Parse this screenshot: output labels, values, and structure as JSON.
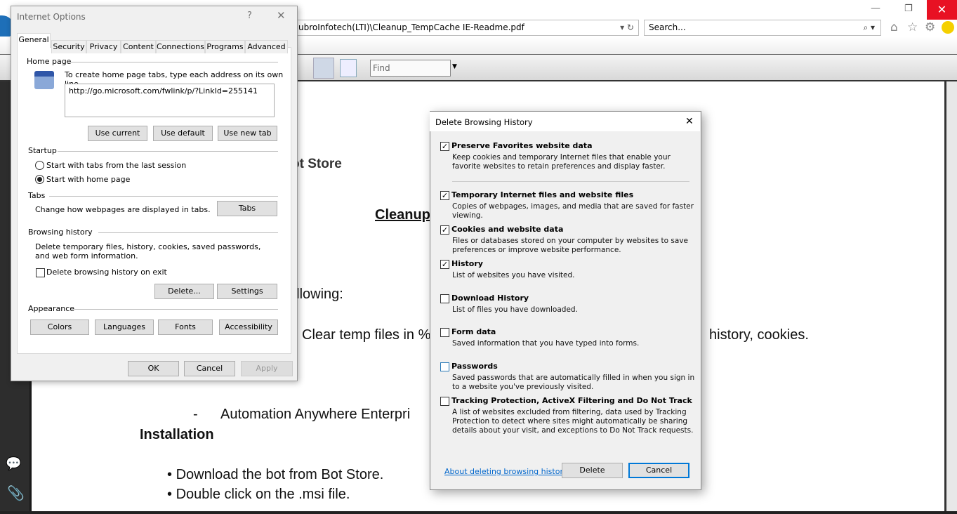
{
  "browser": {
    "address": "ubroInfotech(LTI)\\Cleanup_TempCache IE-Readme.pdf",
    "search_placeholder": "Search...",
    "find_placeholder": "Find"
  },
  "document": {
    "l1": "ot Store",
    "l2": "Cleanup",
    "l3": "ollowing:",
    "l4a": "Clear temp files in %",
    "l4b": "history, cookies.",
    "l5": "-",
    "l6dash": "-",
    "l6": "Automation Anywhere Enterpri",
    "l7": "Installation",
    "b1": "Download the bot from Bot Store.",
    "b2": "Double click on the .msi file.",
    "bullet": "•"
  },
  "internet_options": {
    "title": "Internet Options",
    "help": "?",
    "tabs": [
      "General",
      "Security",
      "Privacy",
      "Content",
      "Connections",
      "Programs",
      "Advanced"
    ],
    "home_page": {
      "label": "Home page",
      "hint": "To create home page tabs, type each address on its own line.",
      "url": "http://go.microsoft.com/fwlink/p/?LinkId=255141",
      "buttons": [
        "Use current",
        "Use default",
        "Use new tab"
      ]
    },
    "startup": {
      "label": "Startup",
      "options": [
        "Start with tabs from the last session",
        "Start with home page"
      ],
      "selected": 1
    },
    "tabs_section": {
      "label": "Tabs",
      "text": "Change how webpages are displayed in tabs.",
      "button": "Tabs"
    },
    "browsing_history": {
      "label": "Browsing history",
      "text": "Delete temporary files, history, cookies, saved passwords, and web form information.",
      "checkbox": "Delete browsing history on exit",
      "checked": false,
      "buttons": [
        "Delete...",
        "Settings"
      ]
    },
    "appearance": {
      "label": "Appearance",
      "buttons": [
        "Colors",
        "Languages",
        "Fonts",
        "Accessibility"
      ]
    },
    "footer": {
      "ok": "OK",
      "cancel": "Cancel",
      "apply": "Apply"
    }
  },
  "delete_history": {
    "title": "Delete Browsing History",
    "items": [
      {
        "title": "Preserve Favorites website data",
        "desc": "Keep cookies and temporary Internet files that enable your favorite websites to retain preferences and display faster.",
        "checked": true
      },
      {
        "title": "Temporary Internet files and website files",
        "desc": "Copies of webpages, images, and media that are saved for faster viewing.",
        "checked": true
      },
      {
        "title": "Cookies and website data",
        "desc": "Files or databases stored on your computer by websites to save preferences or improve website performance.",
        "checked": true
      },
      {
        "title": "History",
        "desc": "List of websites you have visited.",
        "checked": true
      },
      {
        "title": "Download History",
        "desc": "List of files you have downloaded.",
        "checked": false
      },
      {
        "title": "Form data",
        "desc": "Saved information that you have typed into forms.",
        "checked": false
      },
      {
        "title": "Passwords",
        "desc": "Saved passwords that are automatically filled in when you sign in to a website you've previously visited.",
        "checked": false
      },
      {
        "title": "Tracking Protection, ActiveX Filtering and Do Not Track",
        "desc": "A list of websites excluded from filtering, data used by Tracking Protection to detect where sites might automatically be sharing details about your visit, and exceptions to Do Not Track requests.",
        "checked": false
      }
    ],
    "link": "About deleting browsing history",
    "delete": "Delete",
    "cancel": "Cancel"
  }
}
